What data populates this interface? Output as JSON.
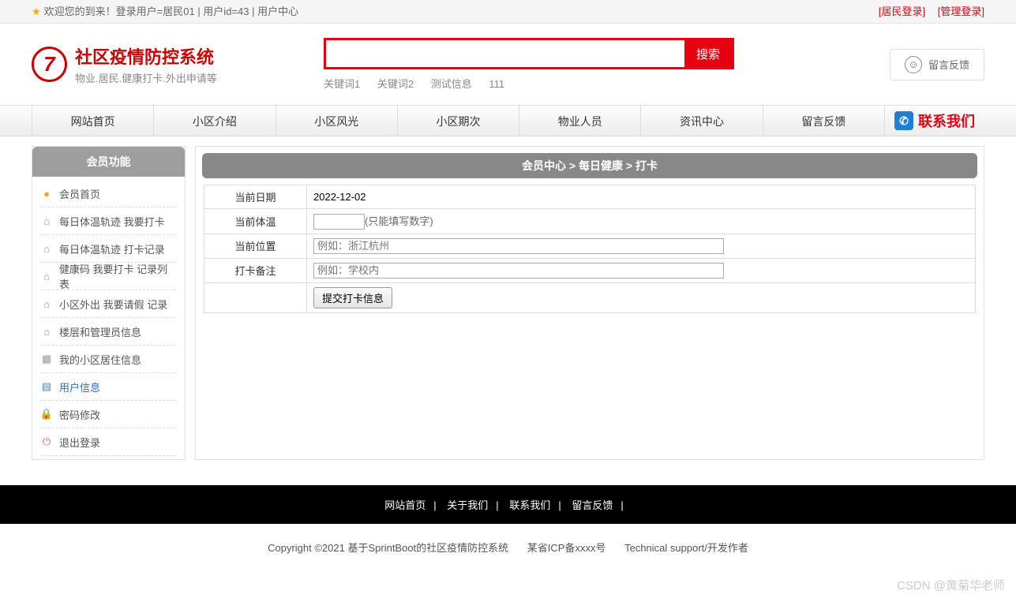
{
  "topbar": {
    "welcome": "欢迎您的到来！登录用户=居民01 | 用户id=43 | 用户中心",
    "login_resident": "[居民登录]",
    "login_admin": "[管理登录]"
  },
  "logo": {
    "title": "社区疫情防控系统",
    "sub": "物业.居民.健康打卡.外出申请等"
  },
  "search": {
    "button": "搜索",
    "keywords": [
      "关键词1",
      "关键词2",
      "测试信息",
      "111"
    ]
  },
  "feedback_btn": "留言反馈",
  "nav": [
    "网站首页",
    "小区介绍",
    "小区风光",
    "小区期次",
    "物业人员",
    "资讯中心",
    "留言反馈"
  ],
  "nav_contact": "联系我们",
  "sidebar": {
    "header": "会员功能",
    "items": [
      "会员首页",
      "每日体温轨迹 我要打卡",
      "每日体温轨迹 打卡记录",
      "健康码 我要打卡 记录列表",
      "小区外出 我要请假 记录",
      "楼层和管理员信息",
      "我的小区居住信息",
      "用户信息",
      "密码修改",
      "退出登录"
    ]
  },
  "breadcrumb": "会员中心 > 每日健康 > 打卡",
  "form": {
    "date_label": "当前日期",
    "date_value": "2022-12-02",
    "temp_label": "当前体温",
    "temp_hint": "(只能填写数字)",
    "loc_label": "当前位置",
    "loc_placeholder": "例如：浙江杭州",
    "note_label": "打卡备注",
    "note_placeholder": "例如：学校内",
    "submit": "提交打卡信息"
  },
  "footer": {
    "nav": [
      "网站首页",
      "关于我们",
      "联系我们",
      "留言反馈"
    ],
    "copy1": "Copyright ©2021 基于SprintBoot的社区疫情防控系统",
    "copy2": "某省ICP备xxxx号",
    "copy3": "Technical support/开发作者"
  },
  "watermark": "CSDN @黄菊华老师"
}
